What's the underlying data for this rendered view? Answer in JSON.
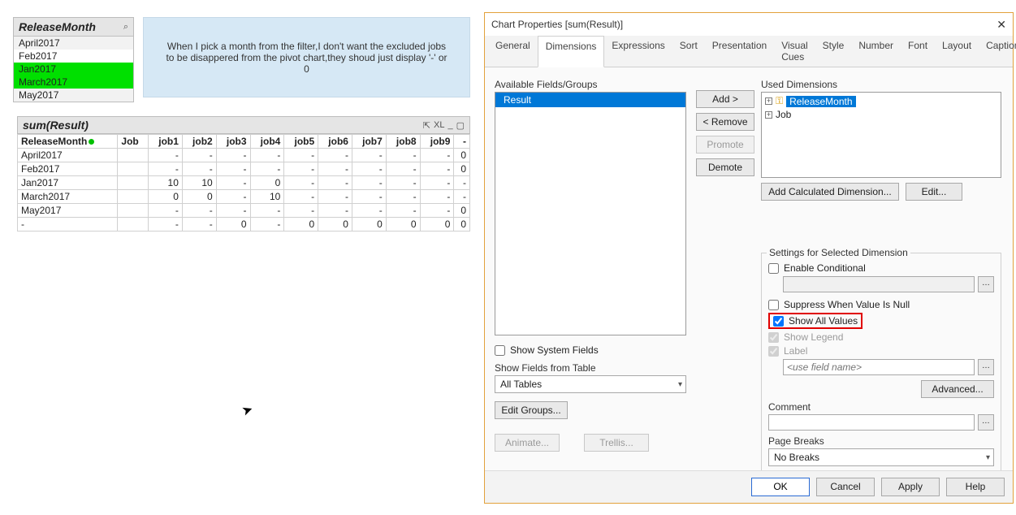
{
  "filter": {
    "title": "ReleaseMonth",
    "items": [
      {
        "label": "April2017",
        "sel": false
      },
      {
        "label": "Feb2017",
        "sel": false
      },
      {
        "label": "Jan2017",
        "sel": true
      },
      {
        "label": "March2017",
        "sel": true
      },
      {
        "label": "May2017",
        "sel": false
      }
    ]
  },
  "note": "When I pick a month from the filter,I don't want the excluded jobs to be disappered from the pivot chart,they shoud just display '-' or 0",
  "pivot": {
    "title": "sum(Result)",
    "tools": {
      "detach": "⇱",
      "xl": "XL",
      "min": "_",
      "max": "▢"
    },
    "dim_cols": [
      "ReleaseMonth",
      "Job"
    ],
    "job_cols": [
      "job1",
      "job2",
      "job3",
      "job4",
      "job5",
      "job6",
      "job7",
      "job8",
      "job9"
    ],
    "trailing_header": "-",
    "rows": [
      {
        "dim": "April2017",
        "vals": [
          "-",
          "-",
          "-",
          "-",
          "-",
          "-",
          "-",
          "-",
          "-"
        ],
        "total": "0"
      },
      {
        "dim": "Feb2017",
        "vals": [
          "-",
          "-",
          "-",
          "-",
          "-",
          "-",
          "-",
          "-",
          "-"
        ],
        "total": "0"
      },
      {
        "dim": "Jan2017",
        "vals": [
          "10",
          "10",
          "-",
          "0",
          "-",
          "-",
          "-",
          "-",
          "-"
        ],
        "total": "-"
      },
      {
        "dim": "March2017",
        "vals": [
          "0",
          "0",
          "-",
          "10",
          "-",
          "-",
          "-",
          "-",
          "-"
        ],
        "total": "-"
      },
      {
        "dim": "May2017",
        "vals": [
          "-",
          "-",
          "-",
          "-",
          "-",
          "-",
          "-",
          "-",
          "-"
        ],
        "total": "0"
      },
      {
        "dim": "-",
        "vals": [
          "-",
          "-",
          "0",
          "-",
          "0",
          "0",
          "0",
          "0",
          "0"
        ],
        "total": "0"
      }
    ]
  },
  "dialog": {
    "title": "Chart Properties [sum(Result)]",
    "tabs": [
      "General",
      "Dimensions",
      "Expressions",
      "Sort",
      "Presentation",
      "Visual Cues",
      "Style",
      "Number",
      "Font",
      "Layout",
      "Caption"
    ],
    "active_tab": "Dimensions",
    "available_label": "Available Fields/Groups",
    "available_items": [
      "Result"
    ],
    "show_system_fields": "Show System Fields",
    "show_fields_from_table": "Show Fields from Table",
    "table_combo": "All Tables",
    "edit_groups": "Edit Groups...",
    "animate": "Animate...",
    "trellis": "Trellis...",
    "mid_buttons": {
      "add": "Add >",
      "remove": "< Remove",
      "promote": "Promote",
      "demote": "Demote"
    },
    "used_label": "Used Dimensions",
    "used_items": [
      {
        "label": "ReleaseMonth",
        "sel": true,
        "key": true
      },
      {
        "label": "Job",
        "sel": false,
        "key": false
      }
    ],
    "add_calc": "Add Calculated Dimension...",
    "edit_btn": "Edit...",
    "settings_legend": "Settings for Selected Dimension",
    "enable_conditional": "Enable Conditional",
    "suppress_null": "Suppress When Value Is Null",
    "show_all_values": "Show All Values",
    "show_legend": "Show Legend",
    "label_chk": "Label",
    "label_placeholder": "<use field name>",
    "advanced": "Advanced...",
    "comment": "Comment",
    "page_breaks": "Page Breaks",
    "page_breaks_value": "No Breaks",
    "footer": {
      "ok": "OK",
      "cancel": "Cancel",
      "apply": "Apply",
      "help": "Help"
    }
  }
}
